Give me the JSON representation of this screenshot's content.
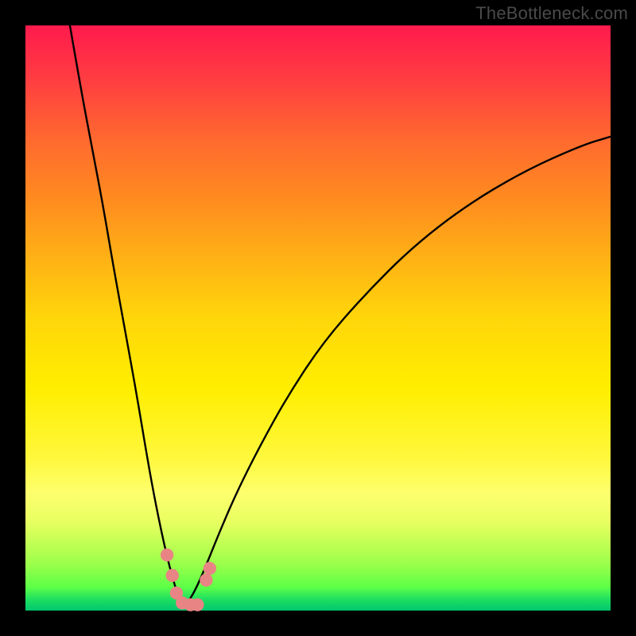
{
  "watermark": "TheBottleneck.com",
  "chart_data": {
    "type": "line",
    "title": "",
    "xlabel": "",
    "ylabel": "",
    "xlim": [
      0,
      100
    ],
    "ylim": [
      0,
      100
    ],
    "notes": "Two curves on a red-to-green vertical gradient. Left curve descends steeply from top-left to a minimum near x≈27; right curve rises from that minimum toward an asymptote at the right edge (~y≈81). A small cluster of salmon-pink markers sits near the trough (x≈24–31, y≈0–7).",
    "series": [
      {
        "name": "left_curve",
        "x": [
          7.6,
          9.5,
          11.4,
          13.3,
          15,
          17,
          19,
          21,
          22.5,
          24,
          25.3,
          26.3,
          27.2
        ],
        "y": [
          100,
          89,
          79,
          69,
          59,
          48,
          37,
          25,
          17,
          10,
          5,
          2,
          0.7
        ]
      },
      {
        "name": "right_curve",
        "x": [
          27.2,
          28.2,
          29.5,
          31,
          33,
          36,
          40,
          45,
          51,
          58,
          66,
          75,
          85,
          95,
          100
        ],
        "y": [
          0.7,
          2,
          4.5,
          8,
          13,
          20,
          28,
          37,
          46,
          54,
          62,
          69,
          75,
          79.5,
          81
        ]
      }
    ],
    "markers": {
      "name": "trough_markers",
      "points": [
        {
          "x": 24.2,
          "y": 9.5
        },
        {
          "x": 25.1,
          "y": 6.0
        },
        {
          "x": 25.8,
          "y": 3.0
        },
        {
          "x": 26.8,
          "y": 1.3
        },
        {
          "x": 28.2,
          "y": 1.0
        },
        {
          "x": 29.4,
          "y": 1.0
        },
        {
          "x": 30.9,
          "y": 5.2
        },
        {
          "x": 31.5,
          "y": 7.2
        }
      ],
      "radius": 8.2
    },
    "colors": {
      "curve": "#000000",
      "marker": "#e98484",
      "gradient_top": "#ff1a4d",
      "gradient_bottom": "#00c66d"
    }
  }
}
